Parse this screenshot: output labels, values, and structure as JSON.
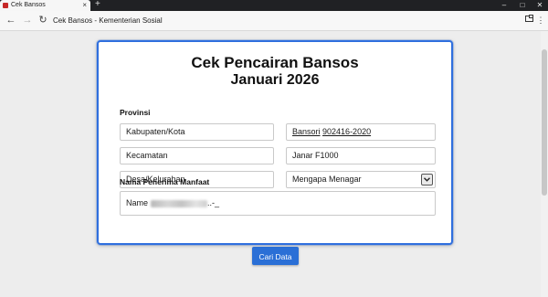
{
  "browser": {
    "tab_title": "Cek Bansos",
    "tab_close": "×",
    "new_tab": "+",
    "window_controls": [
      "–",
      "□",
      "✕"
    ],
    "nav": {
      "back": "←",
      "forward": "→",
      "reload": "↻"
    },
    "address": "Cek Bansos - Kementerian Sosial",
    "favicon_color": "#c62828"
  },
  "form": {
    "title": "Cek Pencairan Bansos",
    "subtitle": "Januari 2026",
    "section_province_label": "Provinsi",
    "left_fields": {
      "kabupaten": "Kabupaten/Kota",
      "kecamatan": "Kecamatan",
      "desa": "Desa/Kelurahan"
    },
    "right_fields": {
      "bansos_label": "Bansori",
      "bansos_code": "902416-2020",
      "program": "Janar F1000",
      "dropdown_value": "Mengapa Menagar"
    },
    "recipient_label": "Nama Penerima Manfaat",
    "recipient_prefix": "Name",
    "recipient_suffix": "..-_",
    "submit_label": "Cari Data"
  },
  "colors": {
    "accent": "#2f6fde",
    "button": "#2a6fd6",
    "background": "#ededed"
  }
}
